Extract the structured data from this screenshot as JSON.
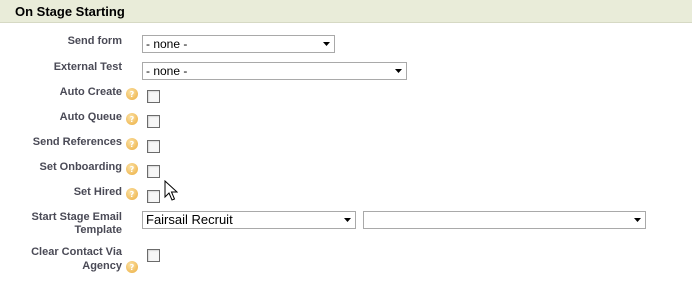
{
  "section": {
    "title": "On Stage Starting"
  },
  "fields": {
    "send_form": {
      "label": "Send form",
      "value": "- none -"
    },
    "external_test": {
      "label": "External Test",
      "value": "- none -"
    },
    "auto_create": {
      "label": "Auto Create",
      "checked": false
    },
    "auto_queue": {
      "label": "Auto Queue",
      "checked": false
    },
    "send_references": {
      "label": "Send References",
      "checked": false
    },
    "set_onboarding": {
      "label": "Set Onboarding",
      "checked": false
    },
    "set_hired": {
      "label": "Set Hired",
      "checked": false
    },
    "start_stage_email_template": {
      "label_line1": "Start Stage Email",
      "label_line2": "Template",
      "value": "Fairsail Recruit",
      "second_value": ""
    },
    "clear_contact_via_agency": {
      "label_line1": "Clear Contact Via",
      "label_line2": "Agency",
      "checked": false
    }
  },
  "icons": {
    "help": "help-icon",
    "dropdown": "chevron-down-icon",
    "cursor": "mouse-pointer-icon"
  },
  "colors": {
    "header_bg": "#e9ecd9",
    "label_text": "#4a4a56",
    "help_icon": "#f3c46b"
  }
}
